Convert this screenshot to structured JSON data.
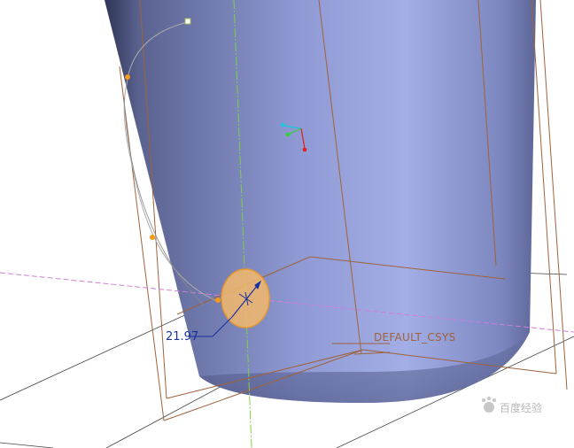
{
  "viewport": {
    "dimension_label": "21.97",
    "csys_label": "DEFAULT_CSYS",
    "watermark_text": "百度经验"
  },
  "colors": {
    "background": "#ffffff",
    "solid_light": "#a3aee6",
    "solid_mid": "#7c86bf",
    "solid_dark": "#3d4468",
    "datum_plane": "#a0623a",
    "datum_axis": "#7ed04a",
    "datum_axis_magenta": "#d07ed8",
    "sketch_circle_fill": "#f3b96b",
    "sketch_circle_stroke": "#e69a2e",
    "dimension": "#1a2fa0",
    "control_point": "#f39a16",
    "trajectory": "#aaaaaa",
    "csys_cyan": "#19c7e0",
    "csys_green": "#31d431",
    "csys_red": "#e02020"
  },
  "icons": {
    "watermark": "paw-logo-icon"
  }
}
